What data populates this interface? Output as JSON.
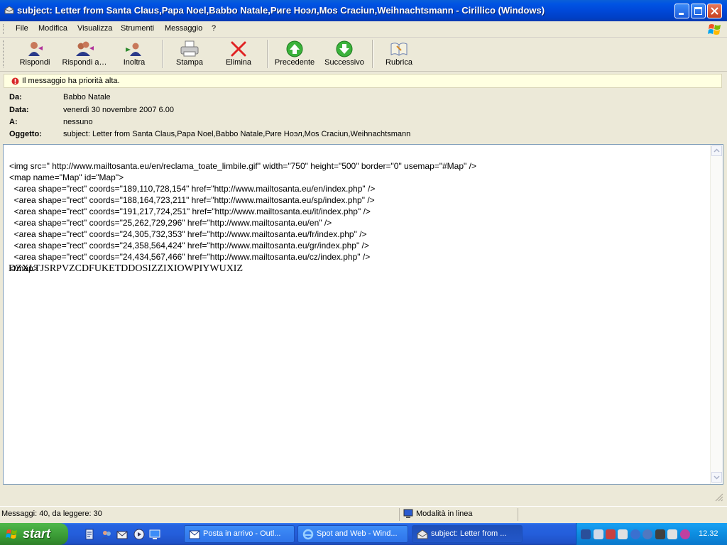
{
  "window": {
    "title": "subject: Letter from Santa Claus,Papa Noel,Babbo Natale,Риге Ноэл,Mos Craciun,Weihnachtsmann - Cirillico (Windows)"
  },
  "menu": {
    "items": [
      "File",
      "Modifica",
      "Visualizza",
      "Strumenti",
      "Messaggio",
      "?"
    ]
  },
  "toolbar": {
    "reply": "Rispondi",
    "reply_all": "Rispondi a…",
    "forward": "Inoltra",
    "print": "Stampa",
    "delete": "Elimina",
    "previous": "Precedente",
    "next": "Successivo",
    "addressbook": "Rubrica"
  },
  "info_bar": {
    "text": "Il messaggio ha priorità alta."
  },
  "header": {
    "from_label": "Da:",
    "from_value": "Babbo Natale",
    "date_label": "Data:",
    "date_value": "venerdì 30 novembre 2007 6.00",
    "to_label": "A:",
    "to_value": "nessuno",
    "subject_label": "Oggetto:",
    "subject_value": "subject: Letter from Santa Claus,Papa Noel,Babbo Natale,Риге Ноэл,Mos Craciun,Weihnachtsmann"
  },
  "body": {
    "lines": [
      "<img src=\" http://www.mailtosanta.eu/en/reclama_toate_limbile.gif\" width=\"750\" height=\"500\" border=\"0\" usemap=\"#Map\" />",
      "<map name=\"Map\" id=\"Map\">",
      "  <area shape=\"rect\" coords=\"189,110,728,154\" href=\"http://www.mailtosanta.eu/en/index.php\" />",
      "  <area shape=\"rect\" coords=\"188,164,723,211\" href=\"http://www.mailtosanta.eu/sp/index.php\" />",
      "  <area shape=\"rect\" coords=\"191,217,724,251\" href=\"http://www.mailtosanta.eu/it/index.php\" />",
      "  <area shape=\"rect\" coords=\"25,262,729,296\" href=\"http://www.mailtosanta.eu/en\" />",
      "  <area shape=\"rect\" coords=\"24,305,732,353\" href=\"http://www.mailtosanta.eu/fr/index.php\" />",
      "  <area shape=\"rect\" coords=\"24,358,564,424\" href=\"http://www.mailtosanta.eu/gr/index.php\" />",
      "  <area shape=\"rect\" coords=\"24,434,567,466\" href=\"http://www.mailtosanta.eu/cz/index.php\" />",
      "</map>"
    ],
    "serif_line": "DZXLTJSRPVZCDFUKETDDOSIZZIXIOWPIYWUXIZ"
  },
  "status": {
    "messages": "Messaggi: 40, da leggere: 30",
    "mode": "Modalità in linea"
  },
  "taskbar": {
    "start": "start",
    "tasks": [
      "Posta in arrivo - Outl...",
      "Spot and Web - Wind...",
      "subject: Letter from ..."
    ],
    "clock": "12.32"
  },
  "colors": {
    "titlebar": "#0054e3",
    "taskbar": "#245edb",
    "start_green": "#3a9a35",
    "infobar_bg": "#ffffe1",
    "chrome": "#ece9d8"
  }
}
